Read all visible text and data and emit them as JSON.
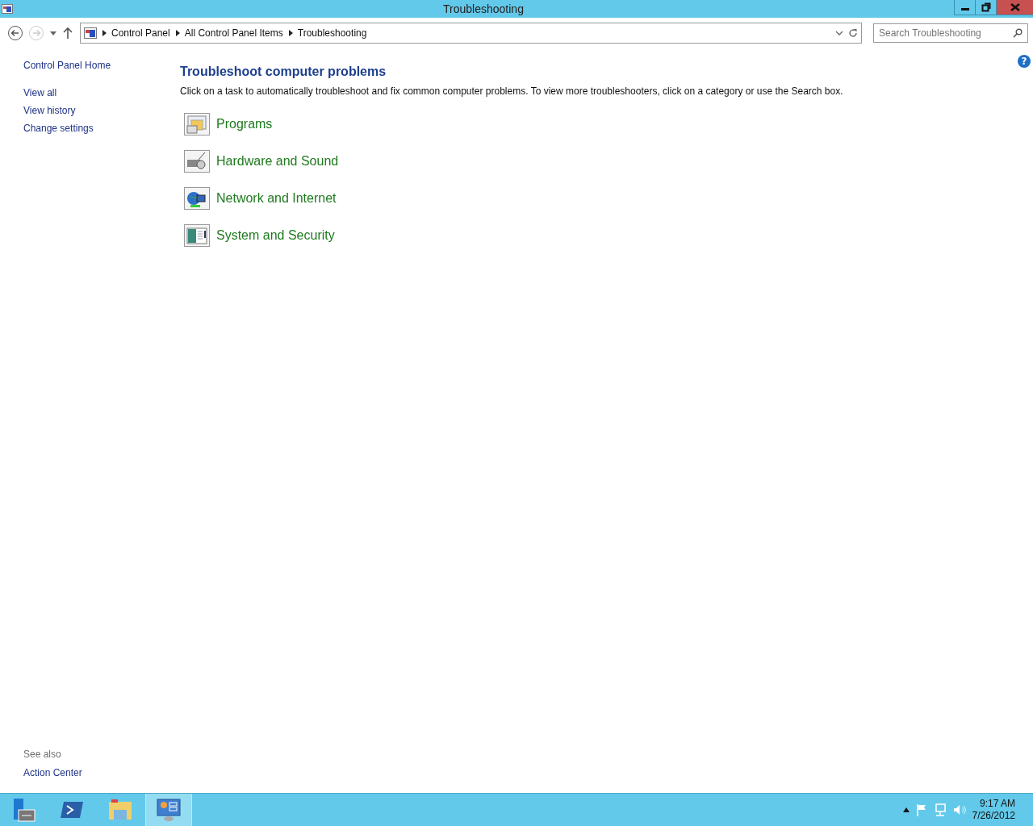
{
  "window": {
    "title": "Troubleshooting"
  },
  "address_bar": {
    "crumbs": [
      "Control Panel",
      "All Control Panel Items",
      "Troubleshooting"
    ]
  },
  "search": {
    "placeholder": "Search Troubleshooting"
  },
  "help": {
    "label": "?"
  },
  "sidebar": {
    "home": "Control Panel Home",
    "links": [
      "View all",
      "View history",
      "Change settings"
    ],
    "see_also_title": "See also",
    "see_also": [
      "Action Center"
    ]
  },
  "content": {
    "heading": "Troubleshoot computer problems",
    "description": "Click on a task to automatically troubleshoot and fix common computer problems. To view more troubleshooters, click on a category or use the Search box.",
    "categories": [
      {
        "kind": "programs",
        "label": "Programs"
      },
      {
        "kind": "hardware",
        "label": "Hardware and Sound"
      },
      {
        "kind": "network",
        "label": "Network and Internet"
      },
      {
        "kind": "system",
        "label": "System and Security"
      }
    ]
  },
  "taskbar": {
    "items": [
      {
        "kind": "server",
        "selected": false
      },
      {
        "kind": "shell",
        "selected": false
      },
      {
        "kind": "folder",
        "selected": false
      },
      {
        "kind": "control",
        "selected": true
      }
    ],
    "time": "9:17 AM",
    "date": "7/26/2012"
  }
}
